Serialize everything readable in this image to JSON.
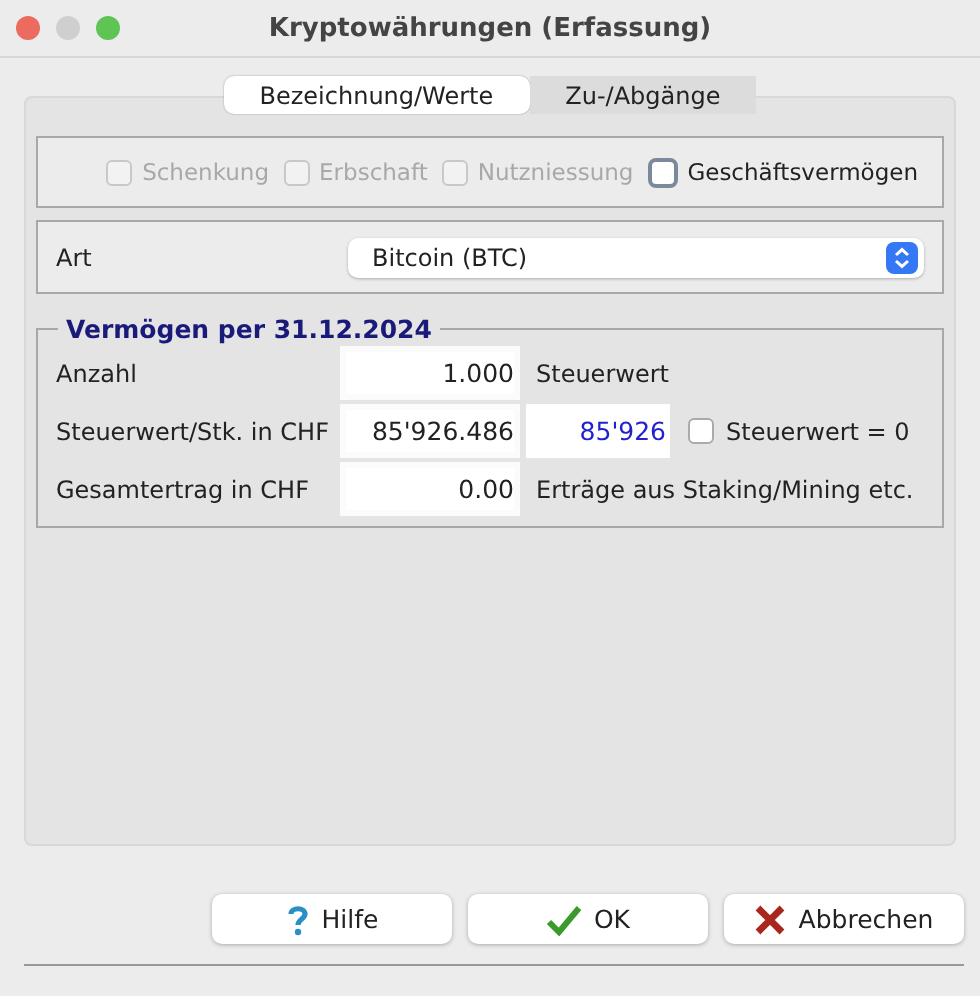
{
  "window": {
    "title": "Kryptowährungen (Erfassung)"
  },
  "tabs": [
    {
      "label": "Bezeichnung/Werte",
      "selected": true
    },
    {
      "label": "Zu-/Abgänge",
      "selected": false
    }
  ],
  "options": [
    {
      "label": "Schenkung",
      "checked": false,
      "disabled": true
    },
    {
      "label": "Erbschaft",
      "checked": false,
      "disabled": true
    },
    {
      "label": "Nutzniessung",
      "checked": false,
      "disabled": true
    },
    {
      "label": "Geschäftsvermögen",
      "checked": false,
      "disabled": false
    }
  ],
  "art": {
    "label": "Art",
    "value": "Bitcoin (BTC)"
  },
  "assets": {
    "legend": "Vermögen per 31.12.2024",
    "rows": [
      {
        "label": "Anzahl",
        "value": "1.000",
        "note": "Steuerwert"
      },
      {
        "label": "Steuerwert/Stk. in CHF",
        "value": "85'926.486",
        "result": "85'926",
        "checkbox": {
          "label": "Steuerwert = 0",
          "checked": false
        }
      },
      {
        "label": "Gesamtertrag in CHF",
        "value": "0.00",
        "note": "Erträge aus Staking/Mining etc."
      }
    ]
  },
  "buttons": [
    {
      "label": "Hilfe",
      "kind": "help"
    },
    {
      "label": "OK",
      "kind": "ok"
    },
    {
      "label": "Abbrechen",
      "kind": "cancel"
    }
  ]
}
